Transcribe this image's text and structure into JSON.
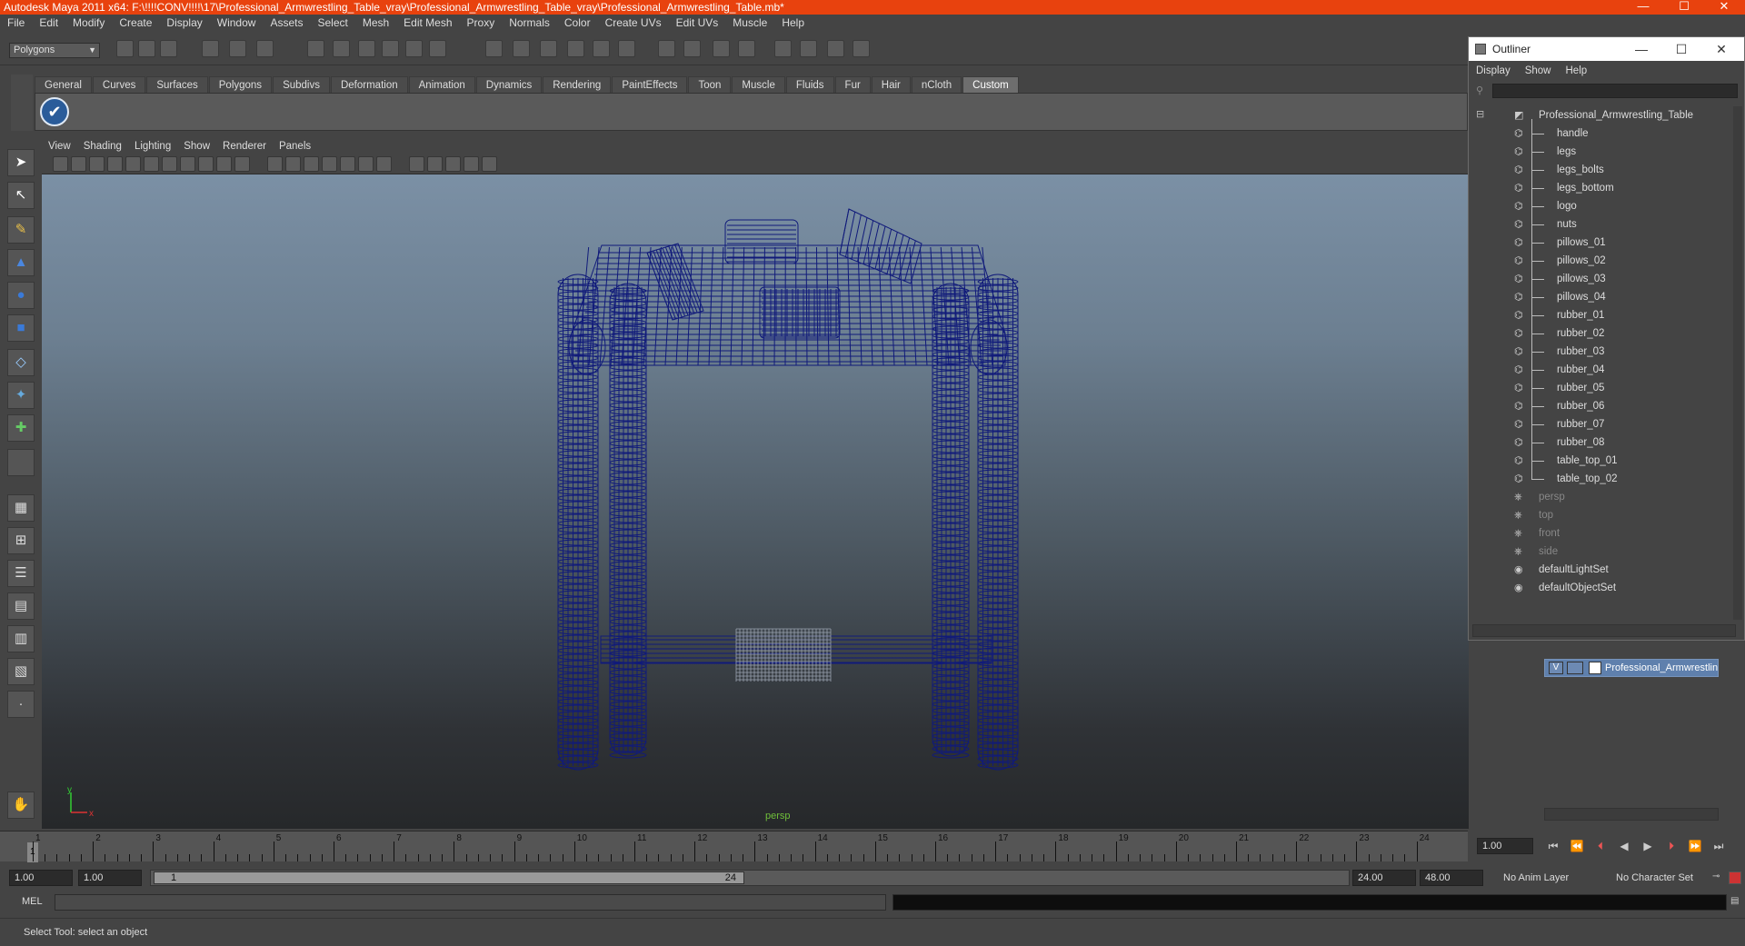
{
  "window": {
    "title": "Autodesk Maya 2011 x64: F:\\!!!!CONV!!!!\\17\\Professional_Armwrestling_Table_vray\\Professional_Armwrestling_Table_vray\\Professional_Armwrestling_Table.mb*",
    "minimize": "—",
    "maximize": "☐",
    "close": "✕"
  },
  "menubar": [
    "File",
    "Edit",
    "Modify",
    "Create",
    "Display",
    "Window",
    "Assets",
    "Select",
    "Mesh",
    "Edit Mesh",
    "Proxy",
    "Normals",
    "Color",
    "Create UVs",
    "Edit UVs",
    "Muscle",
    "Help"
  ],
  "status_line": {
    "mode": "Polygons"
  },
  "shelf": {
    "tabs": [
      "General",
      "Curves",
      "Surfaces",
      "Polygons",
      "Subdivs",
      "Deformation",
      "Animation",
      "Dynamics",
      "Rendering",
      "PaintEffects",
      "Toon",
      "Muscle",
      "Fluids",
      "Fur",
      "Hair",
      "nCloth",
      "Custom"
    ],
    "active_tab": "Custom",
    "icon": "check-icon"
  },
  "panel_menu": [
    "View",
    "Shading",
    "Lighting",
    "Show",
    "Renderer",
    "Panels"
  ],
  "viewport": {
    "camera_label": "persp",
    "axis_y": "y",
    "axis_x": "x",
    "wire_color": "#101a7a"
  },
  "timeline": {
    "ticks": [
      "1",
      "2",
      "3",
      "4",
      "5",
      "6",
      "7",
      "8",
      "9",
      "10",
      "11",
      "12",
      "13",
      "14",
      "15",
      "16",
      "17",
      "18",
      "19",
      "20",
      "21",
      "22",
      "23",
      "24"
    ],
    "current_frame_box": "1",
    "current_time": "1.00"
  },
  "range": {
    "start_time": "1.00",
    "playback_start": "1.00",
    "handle_start": "1",
    "handle_end": "24",
    "playback_end": "24.00",
    "end_time": "48.00",
    "anim_layer": "No Anim Layer",
    "character_set": "No Character Set"
  },
  "command_line": {
    "label": "MEL"
  },
  "help_line": "Select Tool: select an object",
  "outliner": {
    "title": "Outliner",
    "menu": [
      "Display",
      "Show",
      "Help"
    ],
    "root": "Professional_Armwrestling_Table",
    "children": [
      "handle",
      "legs",
      "legs_bolts",
      "legs_bottom",
      "logo",
      "nuts",
      "pillows_01",
      "pillows_02",
      "pillows_03",
      "pillows_04",
      "rubber_01",
      "rubber_02",
      "rubber_03",
      "rubber_04",
      "rubber_05",
      "rubber_06",
      "rubber_07",
      "rubber_08",
      "table_top_01",
      "table_top_02"
    ],
    "cameras": [
      "persp",
      "top",
      "front",
      "side"
    ],
    "sets": [
      "defaultLightSet",
      "defaultObjectSet"
    ]
  },
  "layer_editor": {
    "visible_flag": "V",
    "layer_name": "Professional_Armwrestling"
  }
}
